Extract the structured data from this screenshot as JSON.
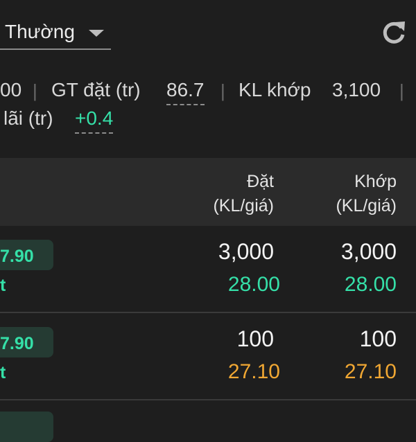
{
  "header": {
    "order_type": "Thường"
  },
  "summary": {
    "row1_cut_value": "00",
    "gt_dat_label": "GT đặt (tr)",
    "gt_dat_value": "86.7",
    "kl_khop_label": "KL khớp",
    "kl_khop_value": "3,100",
    "row2_cut_label": "lãi (tr)",
    "lai_value": "+0.4"
  },
  "table": {
    "col_dat_line1": "Đặt",
    "col_dat_line2": "(KL/giá)",
    "col_khop_line1": "Khớp",
    "col_khop_line2": "(KL/giá)",
    "rows": [
      {
        "price_pill": "7.90",
        "left_cut": "t",
        "dat_qty": "3,000",
        "dat_price": "28.00",
        "khop_qty": "3,000",
        "khop_price": "28.00",
        "price_color": "#35e0a8"
      },
      {
        "price_pill": "7.90",
        "left_cut": "t",
        "dat_qty": "100",
        "dat_price": "27.10",
        "khop_qty": "100",
        "khop_price": "27.10",
        "price_color": "#f0a733"
      }
    ]
  },
  "colors": {
    "background": "#1e1e1e",
    "header_bg": "#2b2b2b",
    "positive": "#35e0a8",
    "neutral_price": "#f0a733"
  }
}
